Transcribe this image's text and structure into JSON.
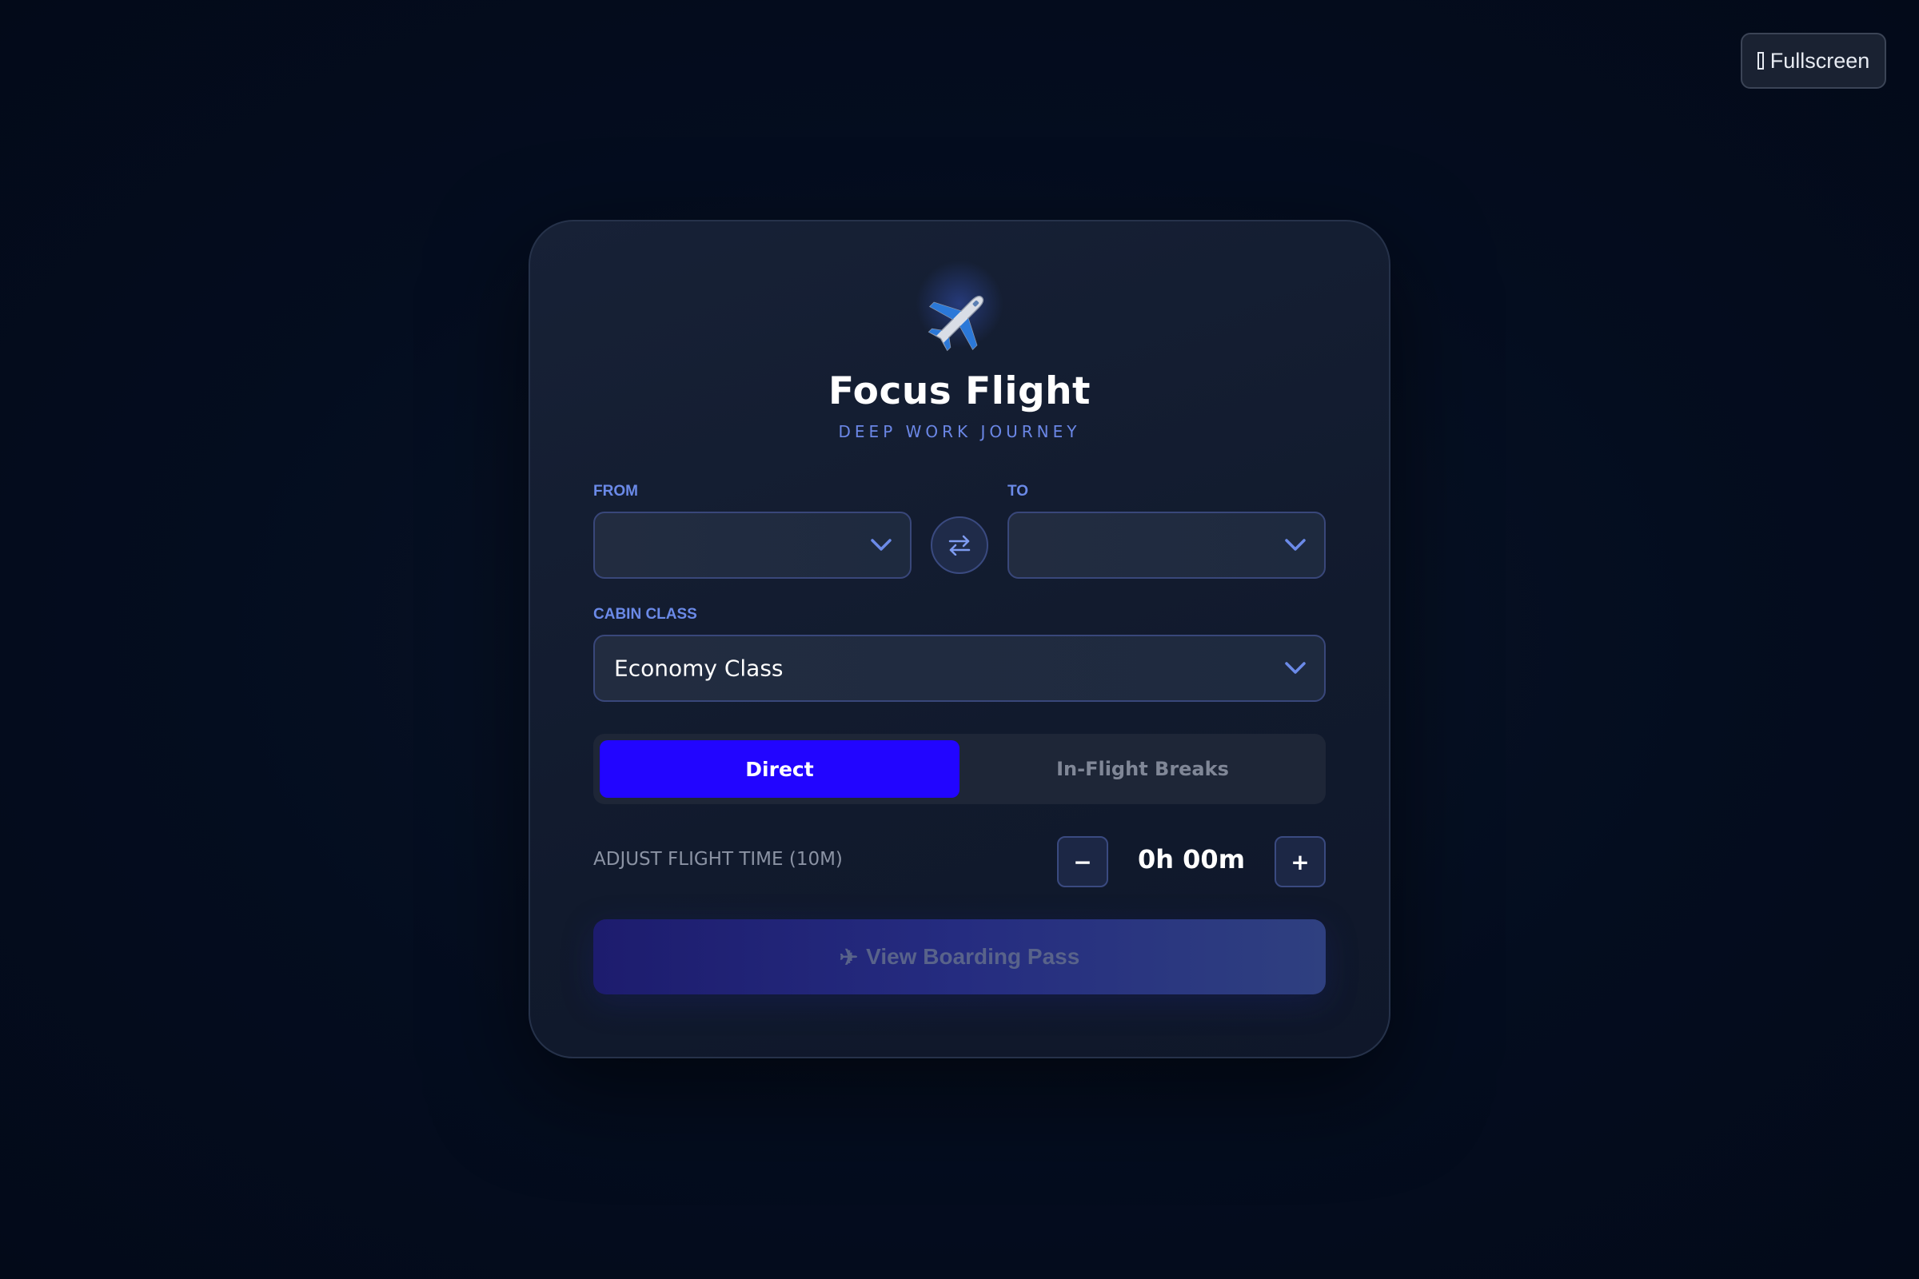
{
  "toolbar": {
    "fullscreen_label": "Fullscreen"
  },
  "header": {
    "title": "Focus Flight",
    "subtitle": "DEEP WORK JOURNEY",
    "logo_icon": "airplane-icon"
  },
  "route": {
    "from_label": "FROM",
    "from_value": "",
    "to_label": "TO",
    "to_value": ""
  },
  "cabin": {
    "label": "CABIN CLASS",
    "value": "Economy Class"
  },
  "mode_toggle": {
    "options": [
      "Direct",
      "In-Flight Breaks"
    ],
    "selected": "Direct"
  },
  "flight_time": {
    "label": "ADJUST FLIGHT TIME (10M)",
    "value": "0h 00m",
    "decrement_label": "−",
    "increment_label": "+"
  },
  "actions": {
    "boarding_pass_label": "View Boarding Pass"
  },
  "colors": {
    "accent": "#2205ff",
    "label_blue": "#6b8ae8",
    "background": "#040d1f"
  }
}
